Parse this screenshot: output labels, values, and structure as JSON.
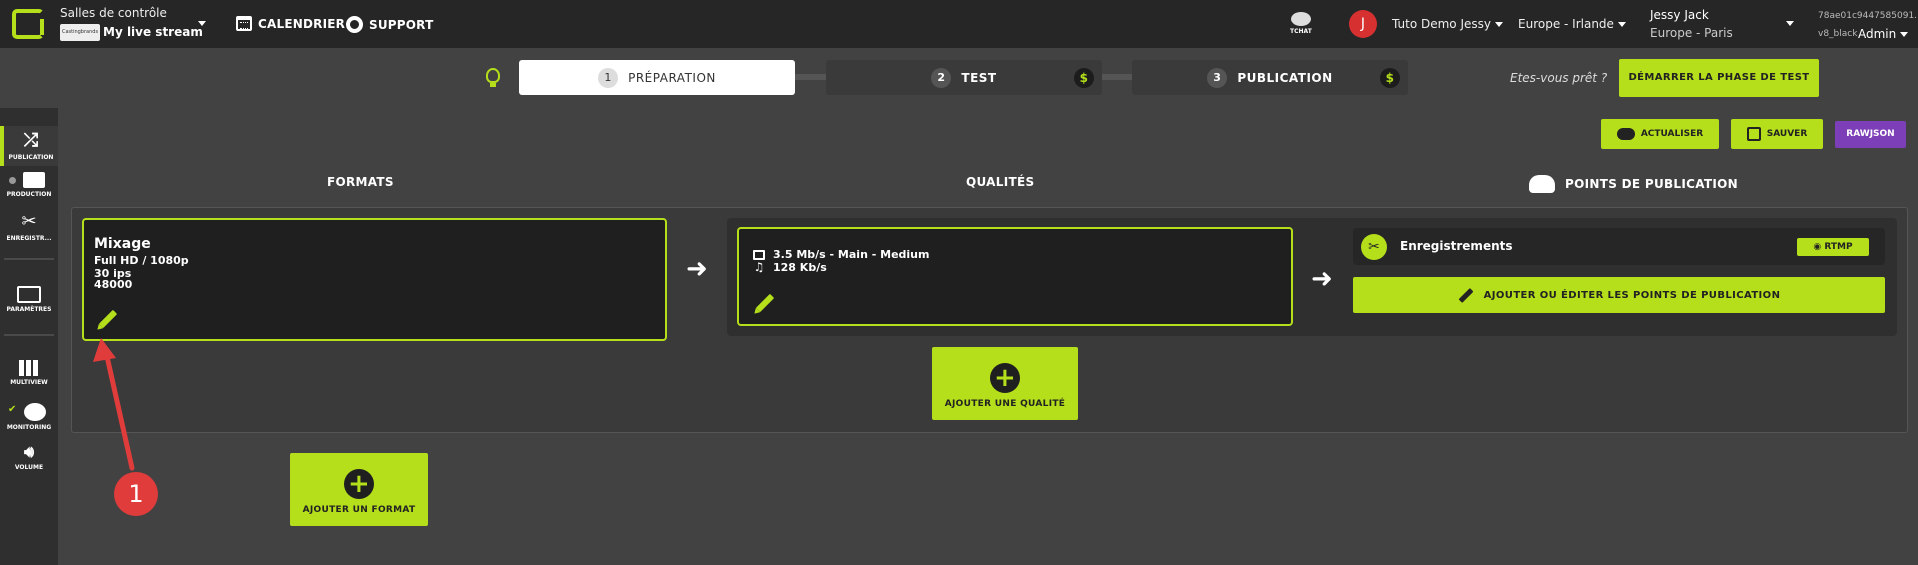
{
  "topbar": {
    "salles_label": "Salles de contrôle",
    "stream_thumb": "Castingbrands",
    "stream_name": "My live stream",
    "calendar_label": "CALENDRIER",
    "support_label": "SUPPORT",
    "tchat_label": "TCHAT",
    "avatar_letter": "J",
    "org_name": "Tuto Demo Jessy",
    "region": "Europe - Irlande",
    "user_name": "Jessy Jack",
    "user_location": "Europe - Paris",
    "session_id": "78ae01c9447585091...",
    "theme": "v8_black",
    "role": "Admin"
  },
  "steps": [
    {
      "num": "1",
      "label": "PRÉPARATION"
    },
    {
      "num": "2",
      "label": "TEST",
      "icon": "$"
    },
    {
      "num": "3",
      "label": "PUBLICATION",
      "icon": "$"
    }
  ],
  "ready_text": "Etes-vous prêt ?",
  "start_test_button": "DÉMARRER LA PHASE DE TEST",
  "sidebar": {
    "items": [
      {
        "label": "PUBLICATION",
        "icon": "shuffle-icon"
      },
      {
        "label": "PRODUCTION",
        "icon": "video-camera-icon"
      },
      {
        "label": "ENREGISTR...",
        "icon": "scissors-icon"
      },
      {
        "label": "PARAMÈTRES",
        "icon": "newspaper-icon"
      },
      {
        "label": "MULTIVIEW",
        "icon": "grid-icon"
      },
      {
        "label": "MONITORING",
        "icon": "dashboard-icon"
      },
      {
        "label": "VOLUME",
        "icon": "volume-icon"
      }
    ]
  },
  "actions": {
    "refresh": "ACTUALISER",
    "save": "SAUVER",
    "rawjson": "RAWJSON"
  },
  "columns": {
    "formats": "FORMATS",
    "qualities": "QUALITÉS",
    "publication_points": "POINTS DE PUBLICATION"
  },
  "format": {
    "title": "Mixage",
    "resolution": "Full HD / 1080p",
    "fps": "30 ips",
    "audio_rate": "48000"
  },
  "quality": {
    "video": "3.5 Mb/s  -  Main  -  Medium",
    "audio": "128 Kb/s"
  },
  "publication": {
    "recording_label": "Enregistrements",
    "rtmp_label": "RTMP",
    "add_edit_label": "AJOUTER OU ÉDITER LES POINTS DE PUBLICATION"
  },
  "add_quality": "AJOUTER UNE QUALITÉ",
  "add_format": "AJOUTER UN FORMAT",
  "annotation_number": "1",
  "colors": {
    "accent": "#b5df1b",
    "rawjson": "#7d3fb8",
    "annotation": "#e03c3c",
    "background": "#424242"
  }
}
